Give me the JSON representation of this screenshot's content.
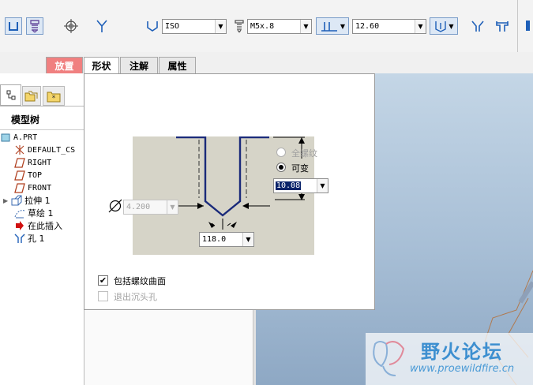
{
  "toolbar": {
    "standard": "ISO",
    "screw_size": "M5x.8",
    "depth_value": "12.60"
  },
  "tabs": [
    {
      "label": "放置"
    },
    {
      "label": "形状"
    },
    {
      "label": "注解"
    },
    {
      "label": "属性"
    }
  ],
  "panel": {
    "header": "模型树",
    "items": [
      {
        "label": "A.PRT"
      },
      {
        "label": "DEFAULT_CS"
      },
      {
        "label": "RIGHT"
      },
      {
        "label": "TOP"
      },
      {
        "label": "FRONT"
      },
      {
        "label": "拉伸 1"
      },
      {
        "label": "草绘 1"
      },
      {
        "label": "在此插入"
      },
      {
        "label": "孔 1"
      }
    ]
  },
  "shape": {
    "thread_full_label": "全螺纹",
    "thread_variable_label": "可变",
    "thread_depth": "10.08",
    "diameter": "4.200",
    "drill_angle": "118.0",
    "include_thread_surface_label": "包括螺纹曲面",
    "exit_countersink_label": "退出沉头孔"
  },
  "watermark": {
    "title": "野火论坛",
    "url": "www.proewildfire.cn"
  },
  "colors": {
    "active_tab": "#f08080",
    "diagram_bg": "#d6d4c8",
    "outline": "#1a2a7a"
  }
}
